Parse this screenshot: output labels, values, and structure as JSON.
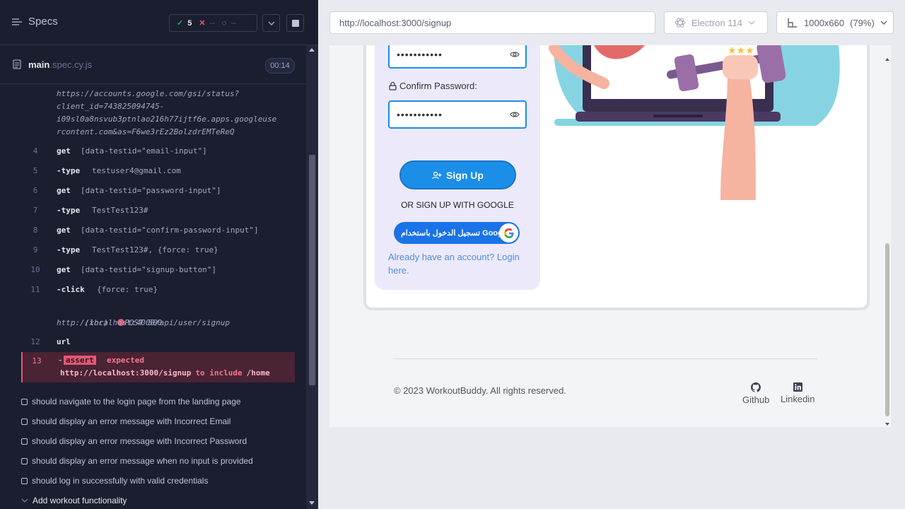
{
  "runner": {
    "specs_label": "Specs",
    "stats": {
      "passed": "5",
      "failed": "--",
      "pending": "--"
    },
    "file": {
      "name": "main",
      "ext": ".spec.cy.js",
      "timer": "00:14"
    },
    "log_header_text": "https://accounts.google.com/gsi/status?\nclient_id=743825094745-\ni09sl0a8nsvub3ptnlao216h77ijtf6e.apps.googleuse\nrcontent.com&as=F6we3rEz2BolzdrEMTeReQ",
    "commands": [
      {
        "num": "4",
        "cmd": "get",
        "arg": "[data-testid=\"email-input\"]"
      },
      {
        "num": "5",
        "cmd": "-type",
        "arg": "testuser4@gmail.com"
      },
      {
        "num": "6",
        "cmd": "get",
        "arg": "[data-testid=\"password-input\"]"
      },
      {
        "num": "7",
        "cmd": "-type",
        "arg": "TestTest123#"
      },
      {
        "num": "8",
        "cmd": "get",
        "arg": "[data-testid=\"confirm-password-input\"]"
      },
      {
        "num": "9",
        "cmd": "-type",
        "arg": "TestTest123#, {force: true}"
      },
      {
        "num": "10",
        "cmd": "get",
        "arg": "[data-testid=\"signup-button\"]"
      },
      {
        "num": "11",
        "cmd": "-click",
        "arg": "{force: true}"
      }
    ],
    "xhr": {
      "label": "(xhr)",
      "status": "POST 500",
      "url": "http://localhost:4000/api/user/signup"
    },
    "url_cmd": {
      "num": "12",
      "cmd": "url"
    },
    "assert": {
      "num": "13",
      "dash": "-",
      "label": "assert",
      "expected": "expected",
      "url": "http://localhost:3000/signup",
      "to_include": "to include",
      "value": "/home"
    },
    "tests": [
      "should navigate to the login page from the landing page",
      "should display an error message with Incorrect Email",
      "should display an error message with Incorrect Password",
      "should display an error message when no input is provided",
      "should log in successfully with valid credentials"
    ],
    "suite": "Add workout functionality"
  },
  "browser": {
    "url": "http://localhost:3000/signup",
    "browser_name": "Electron 114",
    "viewport": "1000x660",
    "scale": "(79%)"
  },
  "app": {
    "password_mask": "•••••••••••",
    "confirm_label": "Confirm Password:",
    "confirm_mask": "•••••••••••",
    "signup_label": "Sign Up",
    "or_google": "OR SIGN UP WITH GOOGLE",
    "google_button": "تسجيل الدخول باستخدام Google",
    "already": "Already have an account? Login here.",
    "copyright": "© 2023 WorkoutBuddy. All rights reserved.",
    "github": "Github",
    "linkedin": "Linkedin"
  },
  "colors": {
    "accent": "#1b8ee8",
    "fail": "#e45770",
    "pass": "#1fa971"
  }
}
